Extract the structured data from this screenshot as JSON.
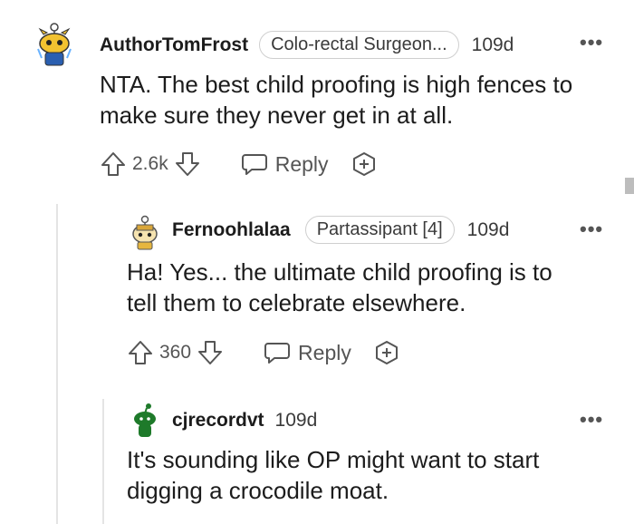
{
  "comments": [
    {
      "username": "AuthorTomFrost",
      "flair": "Colo-rectal Surgeon...",
      "time": "109d",
      "more": "•••",
      "body": [
        "NTA. The best child proofing is high fences to",
        "make sure they never get in at all."
      ],
      "score": "2.6k",
      "reply_label": "Reply"
    },
    {
      "username": "Fernoohlalaa",
      "flair": "Partassipant [4]",
      "time": "109d",
      "more": "•••",
      "body": [
        "Ha! Yes... the ultimate child proofing is to",
        "tell them to celebrate elsewhere."
      ],
      "score": "360",
      "reply_label": "Reply"
    },
    {
      "username": "cjrecordvt",
      "time": "109d",
      "more": "•••",
      "body": [
        "It's sounding like OP might want to start",
        "digging a crocodile moat."
      ]
    }
  ],
  "colors": {
    "text": "#1c1c1c",
    "muted": "#555555",
    "avatar_green": "#1e7a2a",
    "avatar_yellow": "#f2c230"
  },
  "icons": [
    "upvote-icon",
    "downvote-icon",
    "reply-icon",
    "award-icon",
    "more-options-icon"
  ]
}
